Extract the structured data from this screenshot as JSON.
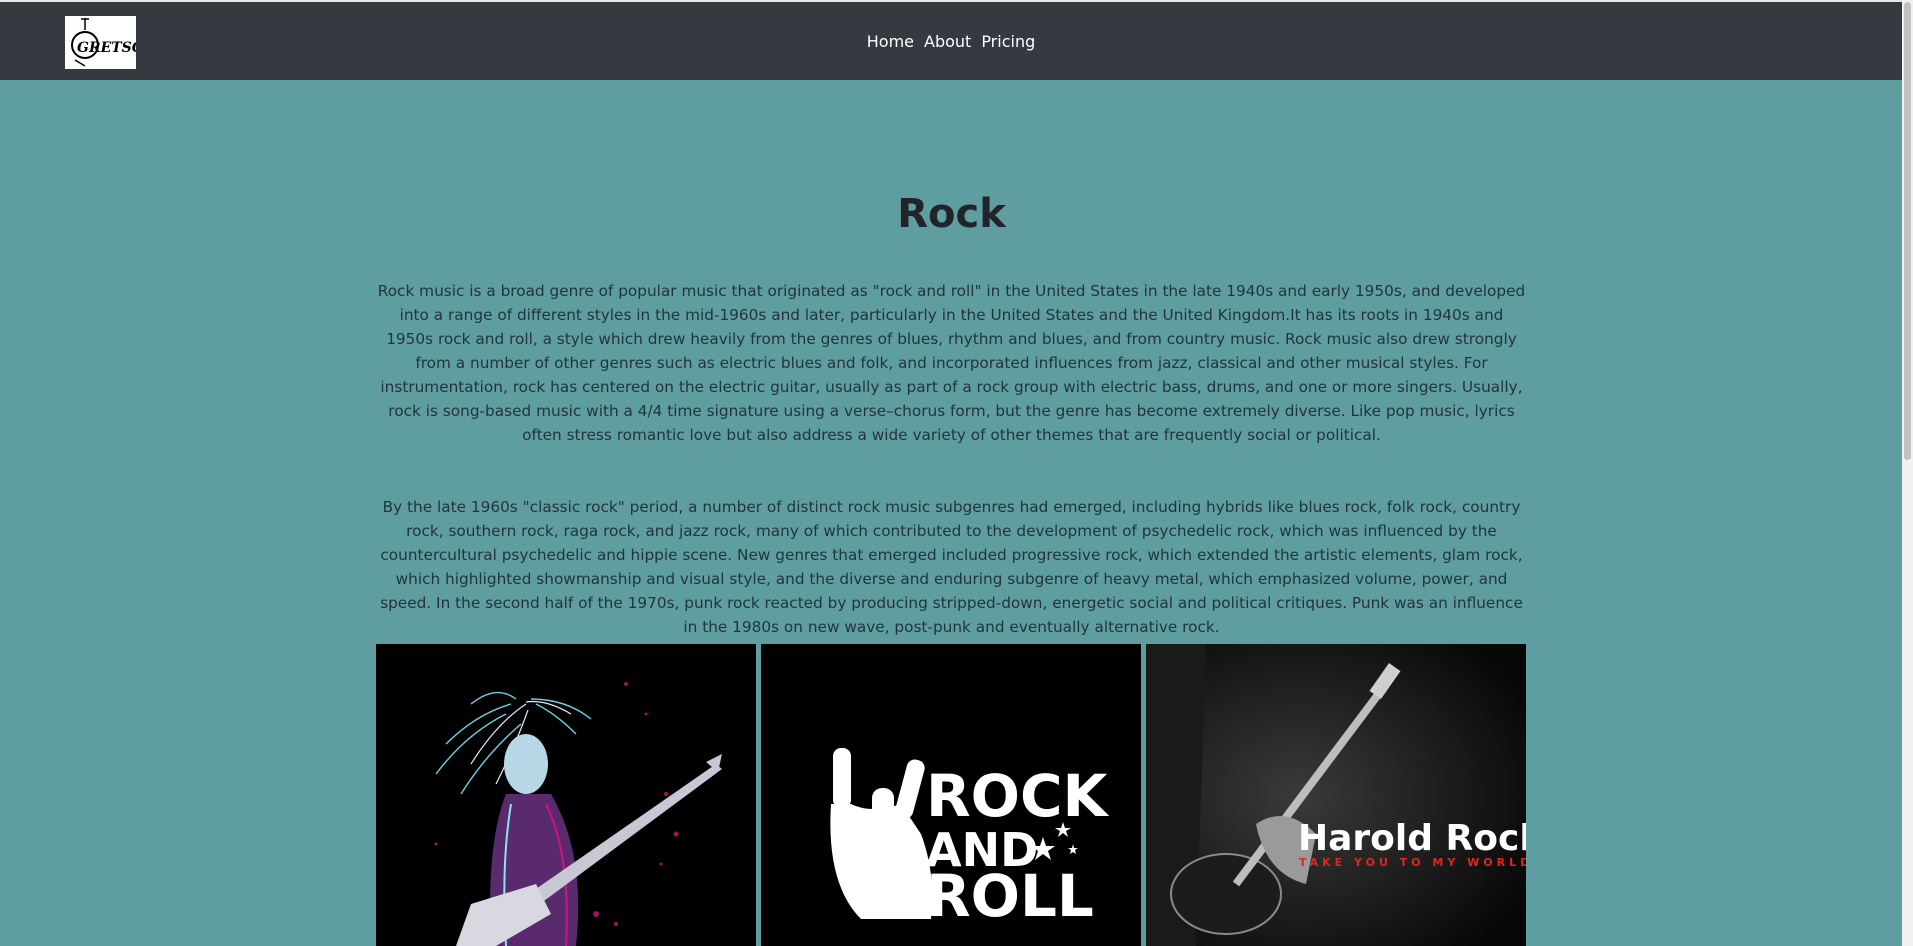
{
  "brand": {
    "logo_text": "GRETSCH"
  },
  "nav": {
    "items": [
      "Home",
      "About",
      "Pricing"
    ]
  },
  "page": {
    "title": "Rock",
    "paragraphs": [
      "Rock music is a broad genre of popular music that originated as \"rock and roll\" in the United States in the late 1940s and early 1950s, and developed into a range of different styles in the mid-1960s and later, particularly in the United States and the United Kingdom.It has its roots in 1940s and 1950s rock and roll, a style which drew heavily from the genres of blues, rhythm and blues, and from country music. Rock music also drew strongly from a number of other genres such as electric blues and folk, and incorporated influences from jazz, classical and other musical styles. For instrumentation, rock has centered on the electric guitar, usually as part of a rock group with electric bass, drums, and one or more singers. Usually, rock is song-based music with a 4/4 time signature using a verse–chorus form, but the genre has become extremely diverse. Like pop music, lyrics often stress romantic love but also address a wide variety of other themes that are frequently social or political.",
      "By the late 1960s \"classic rock\" period, a number of distinct rock music subgenres had emerged, including hybrids like blues rock, folk rock, country rock, southern rock, raga rock, and jazz rock, many of which contributed to the development of psychedelic rock, which was influenced by the countercultural psychedelic and hippie scene. New genres that emerged included progressive rock, which extended the artistic elements, glam rock, which highlighted showmanship and visual style, and the diverse and enduring subgenre of heavy metal, which emphasized volume, power, and speed. In the second half of the 1970s, punk rock reacted by producing stripped-down, energetic social and political critiques. Punk was an influence in the 1980s on new wave, post-punk and eventually alternative rock."
    ]
  },
  "gallery": {
    "images": [
      {
        "name": "rocker-illustration"
      },
      {
        "name": "rock-and-roll-logo",
        "lines": [
          "ROCK",
          "AND",
          "ROLL"
        ]
      },
      {
        "name": "harold-rock-guitar",
        "title": "Harold Rock",
        "tagline": "TAKE YOU TO MY WORLD"
      }
    ]
  },
  "colors": {
    "background": "#5f9ea0",
    "navbar": "#343a40",
    "text": "#212529",
    "accent_red": "#e0261e"
  }
}
